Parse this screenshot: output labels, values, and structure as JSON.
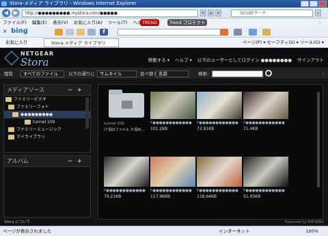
{
  "browser": {
    "title": "Stora-メディア ライブラリ - Windows Internet Explorer",
    "address": "http://●●●●●●●●●.mystora.com/●●●●●",
    "search_placeholder": "SEOBEサーチ",
    "menu": [
      "ファイル(F)",
      "編集(E)",
      "表示(V)",
      "お気に入り(A)",
      "ツール(T)",
      "ヘルプ(H)"
    ],
    "trend_label": "TREND",
    "trend_protect": "Trend プロテクト",
    "bing_label": "bing",
    "favorites_label": "お気に入り",
    "tab_label": "Stora-メディア ライブラリ",
    "toolbar_right": "ページ(P) ▾  セーフティ(S) ▾  ツール(O) ▾",
    "status_done": "ページが表示されました",
    "status_zone": "インターネット",
    "zoom": "100%"
  },
  "app": {
    "brand_top": "NETGEAR",
    "brand_name": "Stora",
    "header_links": [
      "移動する ▾",
      "ヘルプ ▾",
      "以下のユーザーとしてログイン ●●●●●●●●",
      "サインアウト"
    ],
    "toolbar": {
      "view_label": "閲覧",
      "filter_value": "すべてのファイル",
      "sort_prefix": "以下の通りに",
      "thumb_value": "サムネイル",
      "sort_label": "並べ替え",
      "sort_value": "名前",
      "search_label": "検索:"
    },
    "media_source": {
      "title": "メディアソース",
      "tree": [
        {
          "label": "ファミリービデオ"
        },
        {
          "label": "ファミリーフォト"
        },
        {
          "label": "●●●●●●●●●"
        },
        {
          "label": "tunnel 109"
        },
        {
          "label": "ファミリーミュージック"
        },
        {
          "label": "マイライブラリ"
        }
      ]
    },
    "album": {
      "title": "アルバム"
    },
    "grid": [
      {
        "name": "tunnel 109",
        "size": "(7 個のファイル, 0 個の…"
      },
      {
        "name": "F●●●●●●●●●●●●",
        "size": "101.2KB"
      },
      {
        "name": "F●●●●●●●●●●●●",
        "size": "73.91KB"
      },
      {
        "name": "F●●●●●●●●●●●●",
        "size": "71.4KB"
      },
      {
        "name": "F●●●●●●●●●●●●",
        "size": "79.21KB"
      },
      {
        "name": "F●●●●●●●●●●●●",
        "size": "117.96KB"
      },
      {
        "name": "F●●●●●●●●●●●●",
        "size": "118.64KB"
      },
      {
        "name": "F●●●●●●●●●●●●",
        "size": "51.95KB"
      }
    ],
    "footer_left": "Stora について",
    "footer_right": "Powered by HIPSERV"
  }
}
